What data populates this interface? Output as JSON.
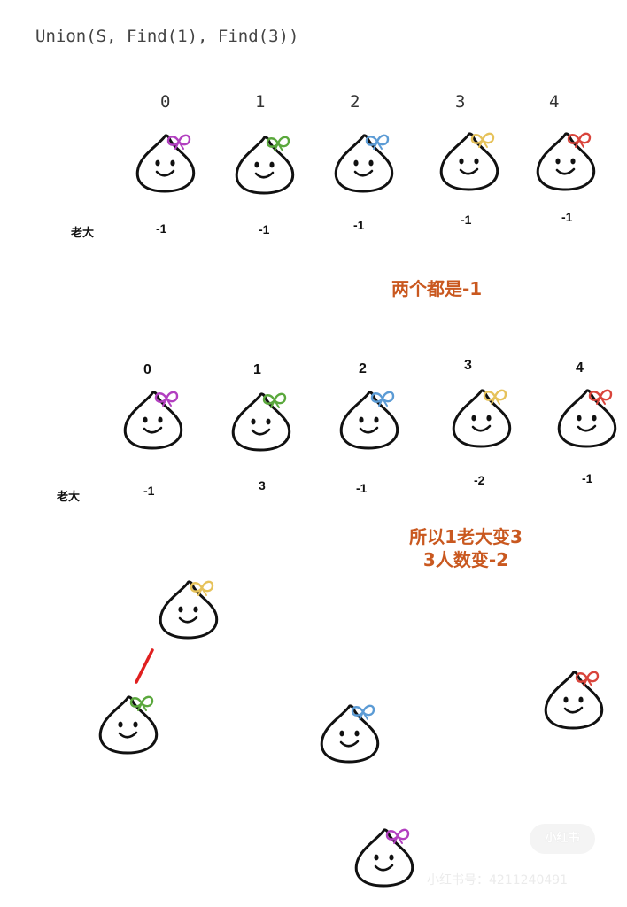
{
  "header": {
    "code_line": "Union(S, Find(1), Find(3))"
  },
  "section1": {
    "indices": [
      "0",
      "1",
      "2",
      "3",
      "4"
    ],
    "boss_label": "老大",
    "parents": [
      "-1",
      "-1",
      "-1",
      "-1",
      "-1"
    ],
    "note": "两个都是-1"
  },
  "section2": {
    "indices": [
      "0",
      "1",
      "2",
      "3",
      "4"
    ],
    "boss_label": "老大",
    "parents": [
      "-1",
      "3",
      "-1",
      "-2",
      "-1"
    ],
    "note_line1": "所以1老大变3",
    "note_line2": "3人数变-2"
  },
  "colors": {
    "note": "#c9581f",
    "bow_0": "#b23fc0",
    "bow_1": "#5aa83c",
    "bow_2": "#5b9bd5",
    "bow_3": "#e6c25a",
    "bow_4": "#d9443b",
    "link_line": "#e02020"
  },
  "watermark": {
    "logo": "小红书",
    "text": "小红书号：4211240491"
  }
}
